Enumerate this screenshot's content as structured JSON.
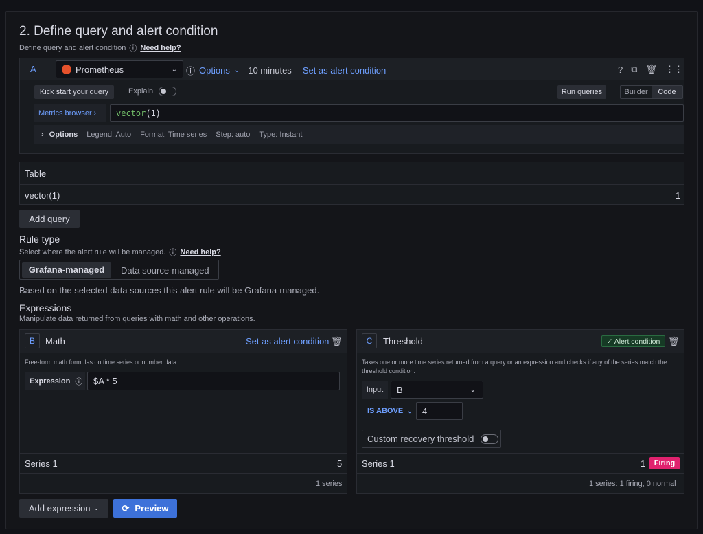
{
  "section": {
    "title": "2. Define query and alert condition",
    "subtitle": "Define query and alert condition",
    "help_link": "Need help?"
  },
  "query": {
    "ref_id": "A",
    "datasource": "Prometheus",
    "options_label": "Options",
    "interval": "10 minutes",
    "set_alert": "Set as alert condition",
    "kick_start": "Kick start your query",
    "explain_label": "Explain",
    "run_queries": "Run queries",
    "builder_tab": "Builder",
    "code_tab": "Code",
    "metrics_browser": "Metrics browser ›",
    "expr_fn": "vector",
    "expr_args": "(1)",
    "options_row": {
      "label": "Options",
      "legend": "Legend: Auto",
      "format": "Format: Time series",
      "step": "Step: auto",
      "type": "Type: Instant"
    }
  },
  "table": {
    "title": "Table",
    "row_label": "vector(1)",
    "row_value": "1"
  },
  "add_query": "Add query",
  "rule_type": {
    "title": "Rule type",
    "subtitle": "Select where the alert rule will be managed.",
    "help_link": "Need help?",
    "options": [
      "Grafana-managed",
      "Data source-managed"
    ],
    "note": "Based on the selected data sources this alert rule will be Grafana-managed."
  },
  "expressions": {
    "title": "Expressions",
    "subtitle": "Manipulate data returned from queries with math and other operations.",
    "math": {
      "ref_id": "B",
      "name": "Math",
      "set_alert": "Set as alert condition",
      "description": "Free-form math formulas on time series or number data.",
      "expression_label": "Expression",
      "expression_value": "$A * 5",
      "series_label": "Series 1",
      "series_value": "5",
      "footer": "1 series"
    },
    "threshold": {
      "ref_id": "C",
      "name": "Threshold",
      "badge": "✓ Alert condition",
      "description": "Takes one or more time series returned from a query or an expression and checks if any of the series match the threshold condition.",
      "input_label": "Input",
      "input_value": "B",
      "operator": "IS ABOVE",
      "threshold_value": "4",
      "recovery_label": "Custom recovery threshold",
      "series_label": "Series 1",
      "series_value": "1",
      "state": "Firing",
      "footer": "1 series: 1 firing, 0 normal"
    }
  },
  "add_expression": "Add expression",
  "preview": "Preview",
  "colors": {
    "accent": "#6e9fff",
    "primary_button": "#3d71d9",
    "firing": "#e0226e",
    "alert_badge": "#1a7f4b"
  }
}
